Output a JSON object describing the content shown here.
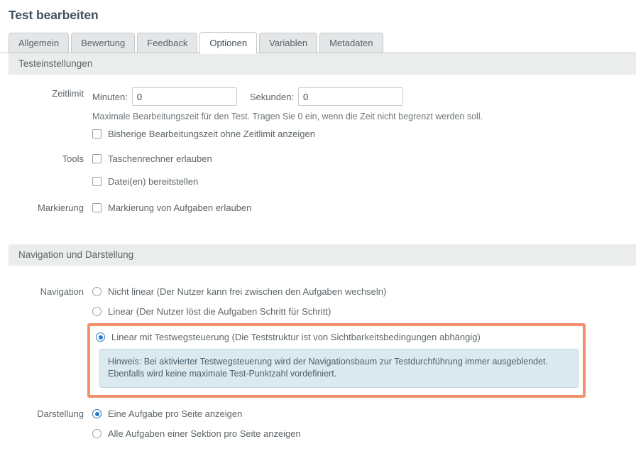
{
  "page": {
    "title": "Test bearbeiten"
  },
  "tabs": [
    {
      "label": "Allgemein",
      "active": false
    },
    {
      "label": "Bewertung",
      "active": false
    },
    {
      "label": "Feedback",
      "active": false
    },
    {
      "label": "Optionen",
      "active": true
    },
    {
      "label": "Variablen",
      "active": false
    },
    {
      "label": "Metadaten",
      "active": false
    }
  ],
  "sections": {
    "test_settings": {
      "heading": "Testeinstellungen",
      "time_limit": {
        "label": "Zeitlimit",
        "minutes_label": "Minuten:",
        "minutes_value": "0",
        "seconds_label": "Sekunden:",
        "seconds_value": "0",
        "help": "Maximale Bearbeitungszeit für den Test. Tragen Sie 0 ein, wenn die Zeit nicht begrenzt werden soll.",
        "show_elapsed": {
          "label": "Bisherige Bearbeitungszeit ohne Zeitlimit anzeigen",
          "checked": false
        }
      },
      "tools": {
        "label": "Tools",
        "options": [
          {
            "label": "Taschenrechner erlauben",
            "checked": false
          },
          {
            "label": "Datei(en) bereitstellen",
            "checked": false
          }
        ]
      },
      "marking": {
        "label": "Markierung",
        "options": [
          {
            "label": "Markierung von Aufgaben erlauben",
            "checked": false
          }
        ]
      }
    },
    "navigation_display": {
      "heading": "Navigation und Darstellung",
      "navigation": {
        "label": "Navigation",
        "options": [
          {
            "label": "Nicht linear (Der Nutzer kann frei zwischen den Aufgaben wechseln)",
            "checked": false
          },
          {
            "label": "Linear (Der Nutzer löst die Aufgaben Schritt für Schritt)",
            "checked": false
          },
          {
            "label": "Linear mit Testwegsteuerung (Die Teststruktur ist von Sichtbarkeitsbedingungen abhängig)",
            "checked": true
          }
        ],
        "hint": "Hinweis: Bei aktivierter Testwegsteuerung wird der Navigationsbaum zur Testdurchführung immer ausgeblendet. Ebenfalls wird keine maximale Test-Punktzahl vordefiniert."
      },
      "display": {
        "label": "Darstellung",
        "options": [
          {
            "label": "Eine Aufgabe pro Seite anzeigen",
            "checked": true
          },
          {
            "label": "Alle Aufgaben einer Sektion pro Seite anzeigen",
            "checked": false
          }
        ]
      }
    }
  },
  "colors": {
    "highlight_border": "#f1906b",
    "info_bg": "#dceaf0",
    "info_border": "#bcd7e1",
    "radio_accent": "#2a79c4",
    "band_bg": "#ebecec"
  }
}
